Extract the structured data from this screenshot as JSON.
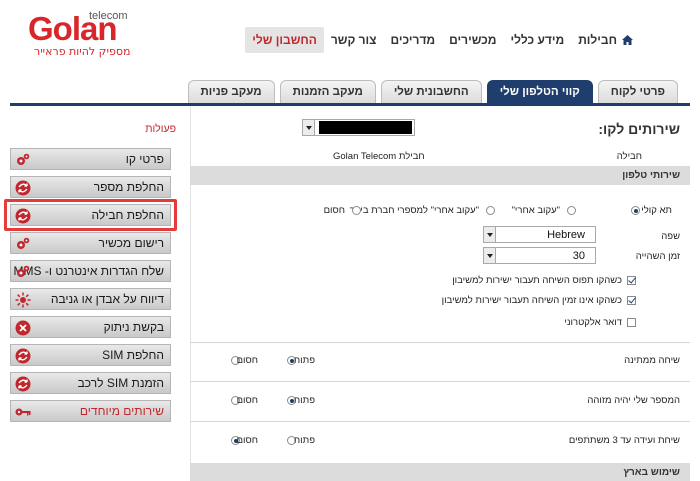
{
  "logo": {
    "brand": "Golan",
    "sub": "telecom",
    "slogan": "מספיק להיות פראייר"
  },
  "nav": {
    "items": [
      "חבילות",
      "מידע כללי",
      "מכשירים",
      "מדריכים",
      "צור קשר",
      "החשבון שלי"
    ],
    "active_index": 5
  },
  "tabs": {
    "items": [
      "פרטי לקוח",
      "קווי הטלפון שלי",
      "החשבונית שלי",
      "מעקב הזמנות",
      "מעקב פניות"
    ],
    "active_index": 1
  },
  "sidebar": {
    "title": "פעולות",
    "actions": [
      {
        "label": "פרטי קו",
        "icon": "gears-icon",
        "name": "action-line-details"
      },
      {
        "label": "החלפת מספר",
        "icon": "swap-icon",
        "name": "action-change-number"
      },
      {
        "label": "החלפת חבילה",
        "icon": "swap-icon",
        "name": "action-change-package"
      },
      {
        "label": "רישום מכשיר",
        "icon": "gears-icon",
        "name": "action-register-device"
      },
      {
        "label": "שלח הגדרות אינטרנט ו- MMS",
        "icon": "gears-icon",
        "name": "action-send-settings"
      },
      {
        "label": "דיווח על אבדן או גניבה",
        "icon": "sun-icon",
        "name": "action-report-loss"
      },
      {
        "label": "בקשת ניתוק",
        "icon": "x-circle-icon",
        "name": "action-disconnect"
      },
      {
        "label": "החלפת SIM",
        "icon": "swap-icon",
        "name": "action-change-sim"
      },
      {
        "label": "הזמנת SIM לרכב",
        "icon": "swap-icon",
        "name": "action-order-car-sim"
      },
      {
        "label": "שירותים מיוחדים",
        "icon": "key-icon",
        "name": "action-special-services",
        "red": true
      }
    ],
    "highlighted_index": 2
  },
  "main": {
    "lines_label": "שירותים לקו:",
    "package_label": "חבילה",
    "package_value": "חבילת Golan Telecom",
    "phone_services_title": "שירותי טלפון",
    "voicemail_options": [
      "תא קולי",
      "\"עקוב אחרי\"",
      "\"עקוב אחרי\" למספרי חברת ביפר",
      "חסום"
    ],
    "voicemail_selected": 0,
    "language_label": "שפה",
    "language_value": "Hebrew",
    "wait_time_label": "זמן השהייה",
    "wait_time_value": "30",
    "checkboxes": [
      {
        "label": "כשהקו תפוס השיחה תעבור ישירות למשיבון",
        "checked": true
      },
      {
        "label": "כשהקו אינו זמין השיחה תעבור ישירות למשיבון",
        "checked": true
      },
      {
        "label": "דואר אלקטרוני",
        "checked": false
      }
    ],
    "open_label": "פתוח",
    "blocked_label": "חסום",
    "rows": [
      {
        "label": "שיחה ממתינה",
        "selected": "open"
      },
      {
        "label": "המספר שלי יהיה מזוהה",
        "selected": "open"
      },
      {
        "label": "שיחת ועידה עד 3 משתתפים",
        "selected": "blocked"
      }
    ],
    "domestic_title": "שימוש בארץ"
  },
  "colors": {
    "brand_red": "#d8262b",
    "navy": "#1f3e6e",
    "highlight": "#e53b3b"
  }
}
